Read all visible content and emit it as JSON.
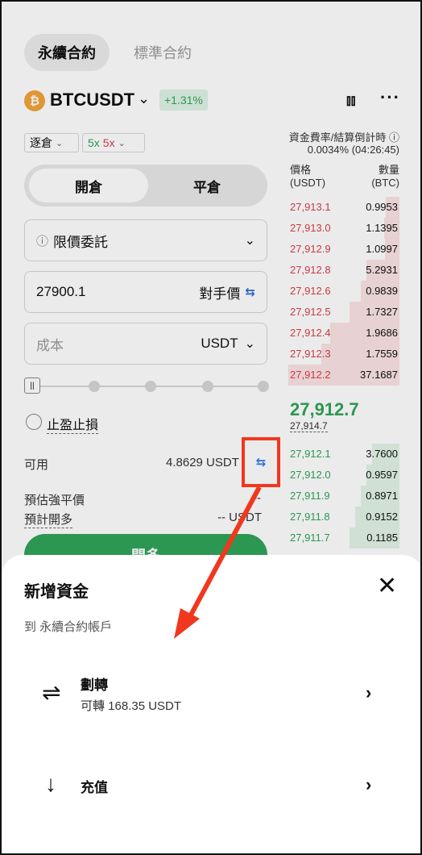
{
  "tabs": [
    {
      "label": "永續合約",
      "active": true
    },
    {
      "label": "標準合約",
      "active": false
    }
  ],
  "header": {
    "coin_icon": "bitcoin-icon",
    "coin_symbol": "₿",
    "pair": "BTCUSDT",
    "change": "+1.31%",
    "chart_icon": "candlestick-icon",
    "more_icon": "more-icon"
  },
  "controls": {
    "margin_mode": "逐倉",
    "leverage_long": "5x",
    "leverage_short": "5x",
    "funding_label": "資金費率/結算倒計時 ⓘ",
    "funding_value": "0.0034% (04:26:45)"
  },
  "segment": {
    "open": "開倉",
    "close": "平倉"
  },
  "order_form": {
    "order_type": "限價委託",
    "price": "27900.1",
    "price_suffix": "對手價",
    "cost_placeholder": "成本",
    "cost_unit": "USDT",
    "tp_sl_label": "止盈止損",
    "available_label": "可用",
    "available_value": "4.8629 USDT",
    "liq_label": "預估強平價",
    "liq_value": "--",
    "est_label": "預計開多",
    "est_value": "-- USDT",
    "buy_label": "開多"
  },
  "orderbook": {
    "price_header": "價格",
    "price_unit": "(USDT)",
    "qty_header": "數量",
    "qty_unit": "(BTC)",
    "asks": [
      {
        "price": "27,913.1",
        "qty": "0.9953",
        "depth": 0.12
      },
      {
        "price": "27,913.0",
        "qty": "1.1395",
        "depth": 0.14
      },
      {
        "price": "27,912.9",
        "qty": "1.0997",
        "depth": 0.13
      },
      {
        "price": "27,912.8",
        "qty": "5.2931",
        "depth": 0.3
      },
      {
        "price": "27,912.6",
        "qty": "0.9839",
        "depth": 0.35
      },
      {
        "price": "27,912.5",
        "qty": "1.7327",
        "depth": 0.45
      },
      {
        "price": "27,912.4",
        "qty": "1.9686",
        "depth": 0.62
      },
      {
        "price": "27,912.3",
        "qty": "1.7559",
        "depth": 0.7
      },
      {
        "price": "27,912.2",
        "qty": "37.1687",
        "depth": 1.0
      }
    ],
    "last_price": "27,912.7",
    "mark_price": "27,914.7",
    "bids": [
      {
        "price": "27,912.1",
        "qty": "3.7600",
        "depth": 0.25
      },
      {
        "price": "27,912.0",
        "qty": "0.9597",
        "depth": 0.3
      },
      {
        "price": "27,911.9",
        "qty": "0.8971",
        "depth": 0.35
      },
      {
        "price": "27,911.8",
        "qty": "0.9152",
        "depth": 0.4
      },
      {
        "price": "27,911.7",
        "qty": "0.1185",
        "depth": 0.45
      }
    ]
  },
  "annotation": {
    "color": "#f0381f"
  },
  "sheet": {
    "title": "新增資金",
    "close_icon": "close-icon",
    "subtitle": "到 永續合約帳戶",
    "options": [
      {
        "icon": "transfer-icon",
        "title": "劃轉",
        "detail": "可轉 168.35 USDT"
      },
      {
        "icon": "deposit-arrow-icon",
        "title": "充值"
      }
    ]
  }
}
